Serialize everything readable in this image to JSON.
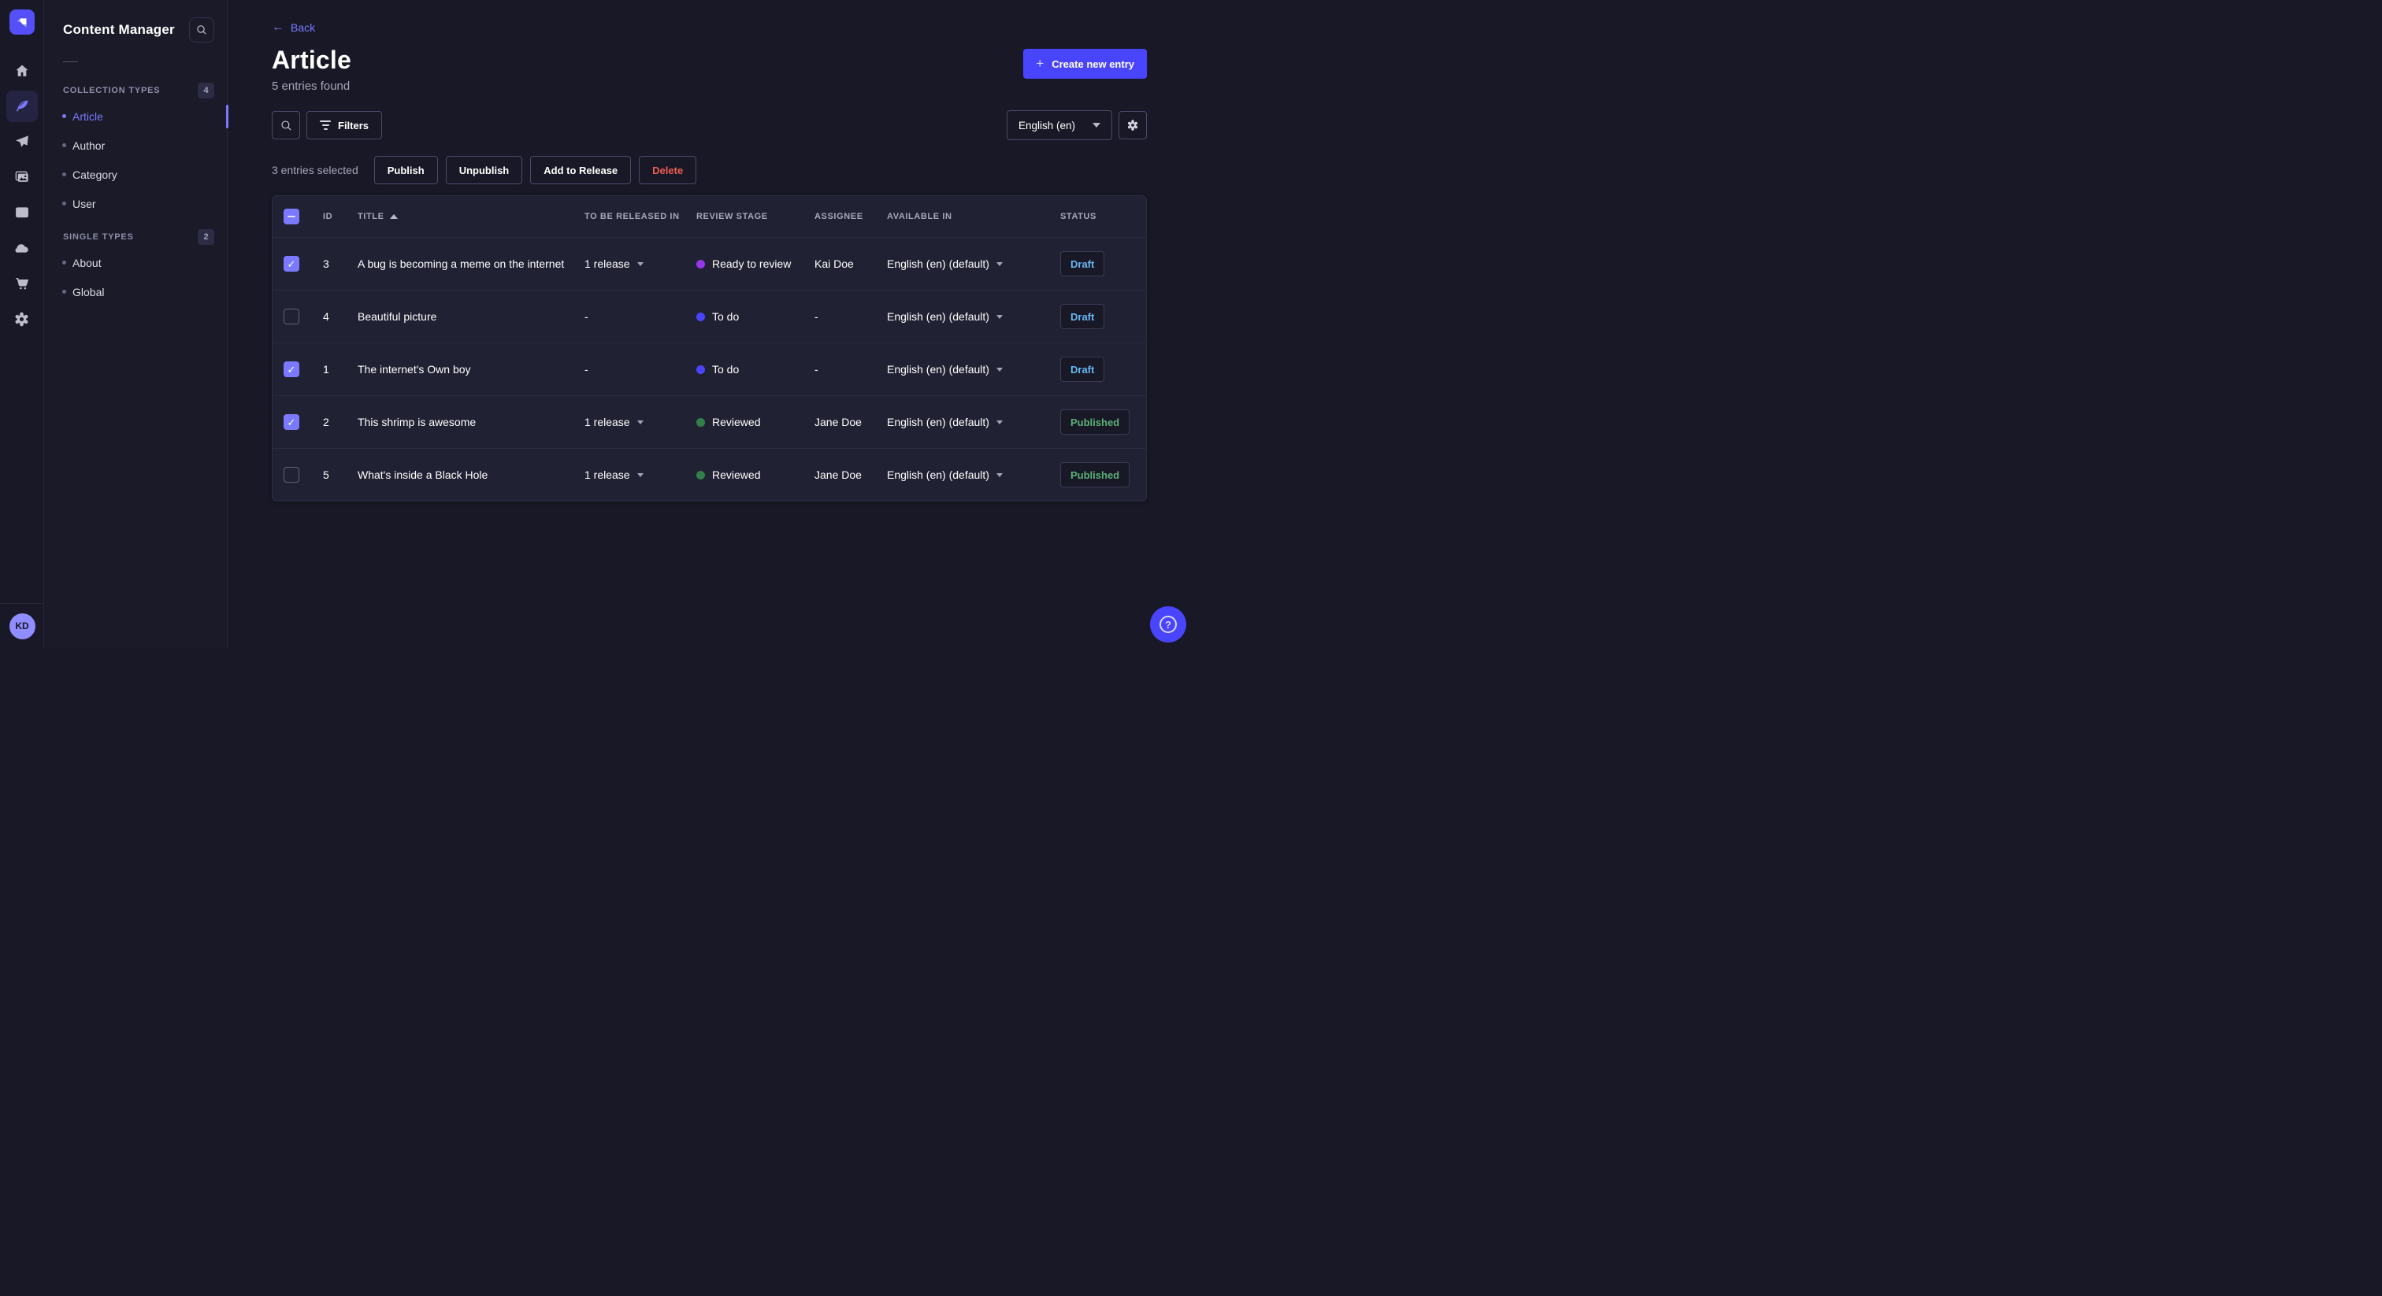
{
  "brand": {
    "accent": "#4945FF",
    "logo": "strapi-logo"
  },
  "rail": {
    "icons": [
      "home",
      "content-manager",
      "paper-plane",
      "media-library",
      "content-type-builder",
      "cloud",
      "marketplace",
      "settings"
    ],
    "active_icon": "content-manager",
    "avatar_initials": "KD"
  },
  "sidebar": {
    "title": "Content Manager",
    "search_icon": "search-icon",
    "sections": [
      {
        "label": "COLLECTION TYPES",
        "count": "4",
        "items": [
          {
            "label": "Article",
            "active": true
          },
          {
            "label": "Author",
            "active": false
          },
          {
            "label": "Category",
            "active": false
          },
          {
            "label": "User",
            "active": false
          }
        ]
      },
      {
        "label": "SINGLE TYPES",
        "count": "2",
        "items": [
          {
            "label": "About",
            "active": false
          },
          {
            "label": "Global",
            "active": false
          }
        ]
      }
    ]
  },
  "header": {
    "back_label": "Back",
    "title": "Article",
    "subtitle": "5 entries found",
    "create_button": "Create new entry"
  },
  "toolbar": {
    "filters_label": "Filters",
    "locale_value": "English (en)"
  },
  "selection": {
    "text": "3 entries selected",
    "publish": "Publish",
    "unpublish": "Unpublish",
    "add_to_release": "Add to Release",
    "delete": "Delete"
  },
  "table": {
    "header_checkbox_state": "indeterminate",
    "sort": {
      "column": "TITLE",
      "direction": "asc"
    },
    "headers": {
      "id": "ID",
      "title": "TITLE",
      "release": "TO BE RELEASED IN",
      "stage": "REVIEW STAGE",
      "assignee": "ASSIGNEE",
      "available": "AVAILABLE IN",
      "status": "STATUS"
    },
    "rows": [
      {
        "selected": true,
        "id": "3",
        "title": "A bug is becoming a meme on the internet",
        "release": "1 release",
        "has_release": true,
        "stage": "Ready to review",
        "stage_color": "#9736E8",
        "assignee": "Kai Doe",
        "available": "English (en) (default)",
        "status": "Draft"
      },
      {
        "selected": false,
        "id": "4",
        "title": "Beautiful picture",
        "release": "-",
        "has_release": false,
        "stage": "To do",
        "stage_color": "#4945FF",
        "assignee": "-",
        "available": "English (en) (default)",
        "status": "Draft"
      },
      {
        "selected": true,
        "id": "1",
        "title": "The internet's Own boy",
        "release": "-",
        "has_release": false,
        "stage": "To do",
        "stage_color": "#4945FF",
        "assignee": "-",
        "available": "English (en) (default)",
        "status": "Draft"
      },
      {
        "selected": true,
        "id": "2",
        "title": "This shrimp is awesome",
        "release": "1 release",
        "has_release": true,
        "stage": "Reviewed",
        "stage_color": "#328048",
        "assignee": "Jane Doe",
        "available": "English (en) (default)",
        "status": "Published"
      },
      {
        "selected": false,
        "id": "5",
        "title": "What's inside a Black Hole",
        "release": "1 release",
        "has_release": true,
        "stage": "Reviewed",
        "stage_color": "#328048",
        "assignee": "Jane Doe",
        "available": "English (en) (default)",
        "status": "Published"
      }
    ]
  },
  "status_colors": {
    "draft": "#66B7F1",
    "published": "#5CB176",
    "danger": "#EE5E52"
  },
  "help": {
    "icon": "question-mark-icon"
  }
}
